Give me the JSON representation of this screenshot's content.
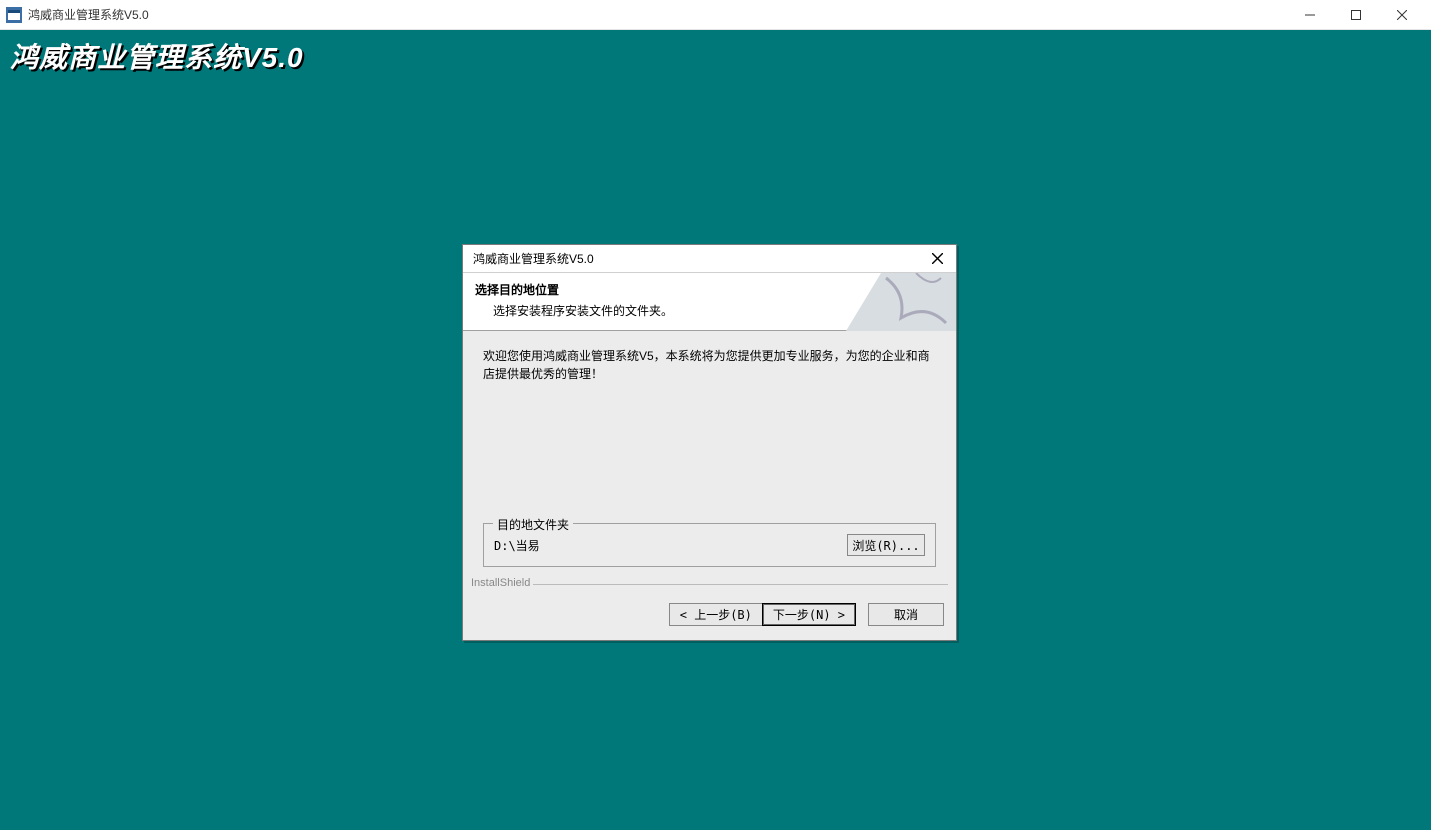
{
  "outerWindow": {
    "title": "鸿威商业管理系统V5.0"
  },
  "brand": "鸿威商业管理系统V5.0",
  "installer": {
    "title": "鸿威商业管理系统V5.0",
    "header": {
      "title": "选择目的地位置",
      "subtitle": "选择安装程序安装文件的文件夹。"
    },
    "welcome": "欢迎您使用鸿威商业管理系统V5，本系统将为您提供更加专业服务，为您的企业和商店提供最优秀的管理！",
    "destination": {
      "legend": "目的地文件夹",
      "path": "D:\\当易",
      "browse": "浏览(R)..."
    },
    "shield": "InstallShield",
    "buttons": {
      "back": "< 上一步(B)",
      "next": "下一步(N) >",
      "cancel": "取消"
    }
  }
}
